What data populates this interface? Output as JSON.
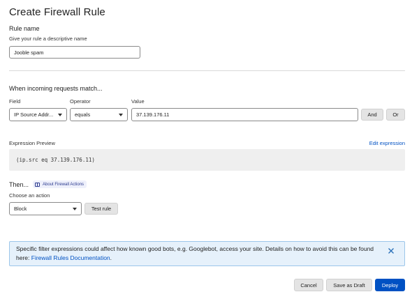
{
  "page": {
    "title": "Create Firewall Rule"
  },
  "rule_name": {
    "label": "Rule name",
    "hint": "Give your rule a descriptive name",
    "value": "Jooble spam"
  },
  "match": {
    "heading": "When incoming requests match...",
    "field_label": "Field",
    "operator_label": "Operator",
    "value_label": "Value",
    "field_value": "IP Source Addr...",
    "operator_value": "equals",
    "value_value": "37.139.176.11",
    "and_label": "And",
    "or_label": "Or"
  },
  "preview": {
    "label": "Expression Preview",
    "edit_link": "Edit expression",
    "expression": "(ip.src eq 37.139.176.11)"
  },
  "then": {
    "heading": "Then...",
    "about_link": "About Firewall Actions",
    "choose_label": "Choose an action",
    "action_value": "Block",
    "test_label": "Test rule"
  },
  "banner": {
    "text": "Specific filter expressions could affect how known good bots, e.g. Googlebot, access your site. Details on how to avoid this can be found here: ",
    "link": "Firewall Rules Documentation",
    "end": "."
  },
  "footer": {
    "cancel": "Cancel",
    "draft": "Save as Draft",
    "deploy": "Deploy"
  },
  "colors": {
    "primary": "#0051c3",
    "banner_bg": "#e6f1fb",
    "banner_border": "#9cc6ea"
  },
  "icons": [
    "caret-down-icon",
    "book-icon",
    "close-icon"
  ]
}
